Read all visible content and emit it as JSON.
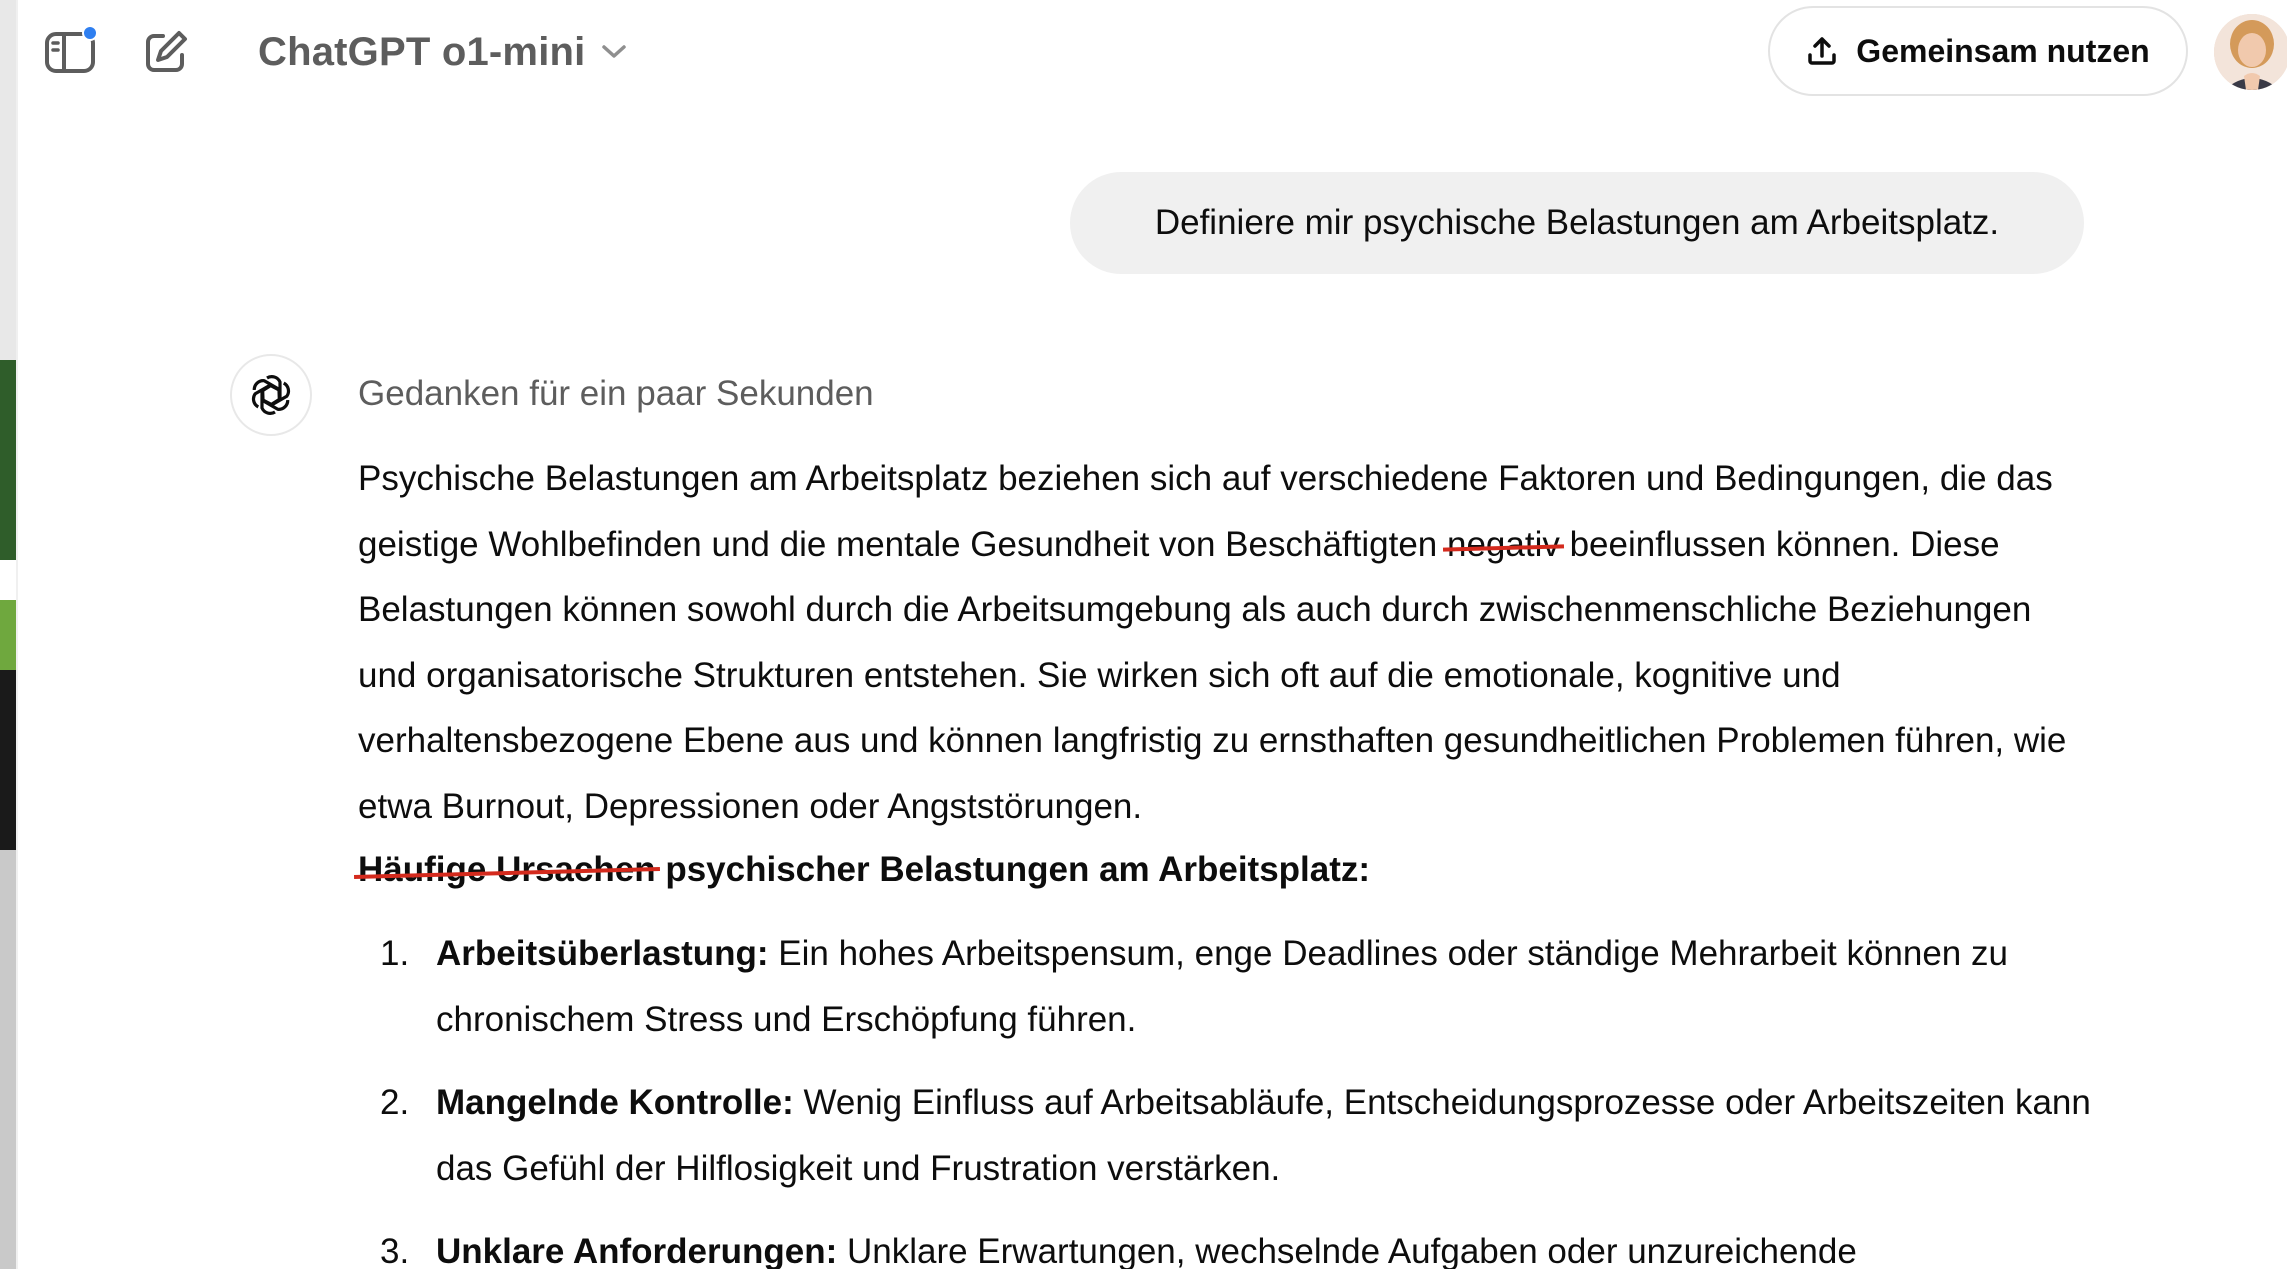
{
  "header": {
    "model_name": "ChatGPT o1-mini",
    "share_label": "Gemeinsam nutzen",
    "icons": {
      "sidebar": "sidebar-toggle-icon",
      "new_chat": "edit-icon",
      "chevron": "chevron-down-icon",
      "share": "upload-icon"
    },
    "notification_color": "#2f7ff0"
  },
  "user_message": "Definiere mir psychische Belastungen am Arbeitsplatz.",
  "assistant": {
    "thinking_label": "Gedanken für ein paar Sekunden",
    "intro": {
      "part1": "Psychische Belastungen am Arbeitsplatz beziehen sich auf verschiedene Faktoren und Bedingungen, die das geistige Wohlbefinden und die mentale Gesundheit von Beschäftigten ",
      "struck_word": "negativ",
      "part2": " beeinflussen können. Diese Belastungen können sowohl durch die Arbeitsumgebung als auch durch zwischenmenschliche Beziehungen und organisatorische Strukturen entstehen. Sie wirken sich oft auf die emotionale, kognitive und verhaltensbezogene Ebene aus und können langfristig zu ernsthaften gesundheitlichen Problemen führen, wie etwa Burnout, Depressionen oder Angststörungen."
    },
    "heading": {
      "struck": "Häufige Ursachen",
      "rest": " psychischer Belastungen am Arbeitsplatz:"
    },
    "list": [
      {
        "num": "1.",
        "term": "Arbeitsüberlastung:",
        "text": " Ein hohes Arbeitspensum, enge Deadlines oder ständige Mehrarbeit können zu chronischem Stress und Erschöpfung führen."
      },
      {
        "num": "2.",
        "term": "Mangelnde Kontrolle:",
        "text": " Wenig Einfluss auf Arbeitsabläufe, Entscheidungsprozesse oder Arbeitszeiten kann das Gefühl der Hilflosigkeit und Frustration verstärken."
      },
      {
        "num": "3.",
        "term": "Unklare Anforderungen:",
        "text": " Unklare Erwartungen, wechselnde Aufgaben oder unzureichende"
      }
    ],
    "strike_color": "#d42a1d"
  }
}
